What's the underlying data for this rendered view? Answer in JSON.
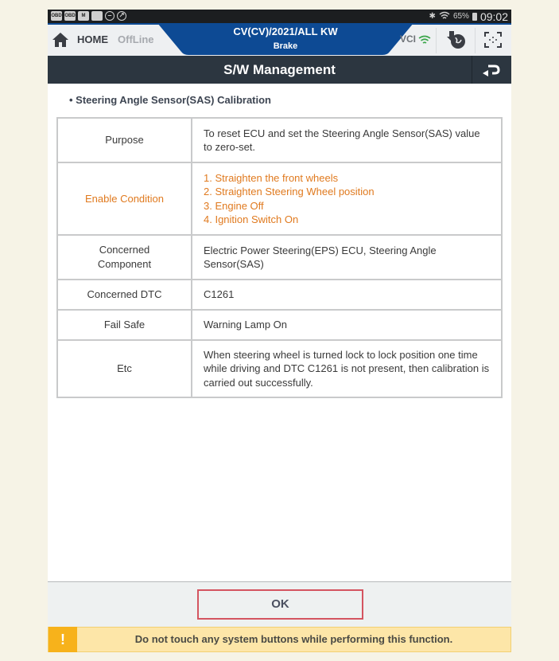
{
  "status_bar": {
    "left_icons": [
      "obd-icon",
      "obd-icon",
      "gmail-icon",
      "sd-card-icon",
      "do-not-disturb-icon",
      "compass-icon"
    ],
    "bluetooth_icon": "bluetooth-icon",
    "wifi_icon": "wifi-icon",
    "battery_percent": "65%",
    "time": "09:02"
  },
  "header": {
    "home_label": "HOME",
    "mode_label": "OffLine",
    "vehicle": "CV(CV)/2021/ALL KW",
    "system": "Brake",
    "vci_label": "VCI",
    "colors": {
      "accent_blue": "#0d4a94",
      "vci_green": "#3aa64a"
    }
  },
  "titlebar": {
    "title": "S/W Management"
  },
  "content": {
    "section_title": "• Steering Angle Sensor(SAS) Calibration",
    "rows": [
      {
        "label": "Purpose",
        "value": [
          "To reset ECU and set the Steering Angle Sensor(SAS) value to zero-set."
        ],
        "highlight": false
      },
      {
        "label": "Enable Condition",
        "value": [
          "1. Straighten the front wheels",
          "2. Straighten Steering Wheel position",
          "3. Engine Off",
          "4. Ignition Switch On"
        ],
        "highlight": true
      },
      {
        "label": "Concerned Component",
        "value": [
          "Electric Power Steering(EPS) ECU, Steering Angle Sensor(SAS)"
        ],
        "highlight": false
      },
      {
        "label": "Concerned DTC",
        "value": [
          "C1261"
        ],
        "highlight": false
      },
      {
        "label": "Fail Safe",
        "value": [
          "Warning Lamp On"
        ],
        "highlight": false
      },
      {
        "label": "Etc",
        "value": [
          "When steering wheel is turned lock to lock position one time while driving and DTC C1261 is not present, then calibration is carried out successfully."
        ],
        "highlight": false
      }
    ],
    "highlight_color": "#e07a1f"
  },
  "footer": {
    "ok_label": "OK",
    "warning_icon": "!",
    "warning_text": "Do not touch any system buttons while performing this function."
  }
}
